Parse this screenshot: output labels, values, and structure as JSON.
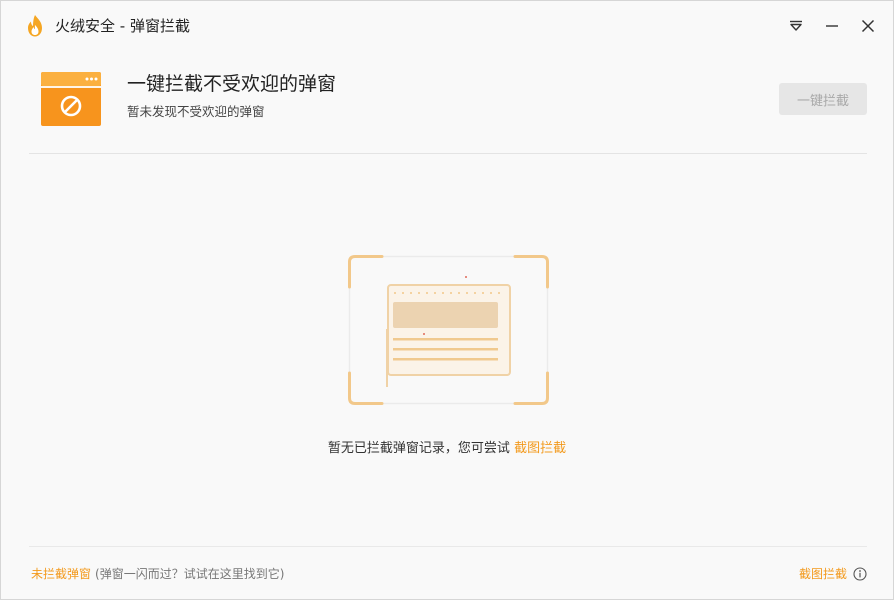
{
  "window": {
    "title": "火绒安全 - 弹窗拦截"
  },
  "header": {
    "title": "一键拦截不受欢迎的弹窗",
    "subtitle": "暂未发现不受欢迎的弹窗",
    "block_button_label": "一键拦截"
  },
  "empty_state": {
    "message": "暂无已拦截弹窗记录，您可尝试",
    "link_label": "截图拦截"
  },
  "footer": {
    "unblocked_link": "未拦截弹窗",
    "hint": "(弹窗一闪而过？试试在这里找到它)",
    "screenshot_block_link": "截图拦截"
  },
  "icons": {
    "app": "flame-logo-icon",
    "menu": "dropdown-menu-icon",
    "minimize": "minimize-icon",
    "close": "close-icon",
    "header": "blocked-window-icon",
    "illustration": "empty-popup-illustration",
    "info": "info-icon"
  },
  "colors": {
    "accent": "#f39a1d",
    "background": "#f9f9f9",
    "disabled_button": "#e6e6e6"
  }
}
